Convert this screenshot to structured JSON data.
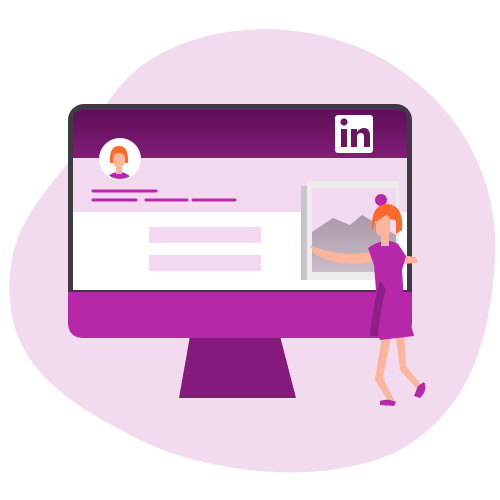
{
  "logo": {
    "text": "in",
    "name": "linkedin-logo"
  },
  "colors": {
    "background_blob": "#f2dbef",
    "bezel": "#3f3a42",
    "header": "#7d1a72",
    "header_dark": "#5e0f58",
    "profile_band": "#f2d9f0",
    "content": "#ffffff",
    "accent": "#b628a8",
    "stand": "#831a7c",
    "hair": "#fb6a2c",
    "skin": "#fbb59c",
    "photo_frame": "#ececec",
    "mountain": "#b8a6b6"
  }
}
